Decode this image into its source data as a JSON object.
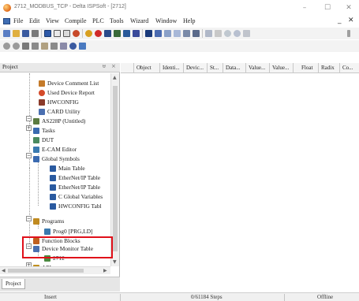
{
  "window": {
    "title": "2712_MODBUS_TCP - Delta ISPSoft - [2712]",
    "controls": [
      "–",
      "☐",
      "✕"
    ]
  },
  "menubar": {
    "items": [
      "File",
      "Edit",
      "View",
      "Compile",
      "PLC",
      "Tools",
      "Wizard",
      "Window",
      "Help"
    ],
    "right_controls": [
      "_",
      "✕"
    ]
  },
  "project_panel": {
    "title": "Project",
    "pin_glyph": "ᵾ",
    "close_glyph": "×",
    "tab_label": "Project",
    "tree": [
      {
        "label": "Device Comment List",
        "icon": "comment-list-icon",
        "color": "#c47a2a"
      },
      {
        "label": "Used Device Report",
        "icon": "report-icon",
        "color": "#d44a2a"
      },
      {
        "label": "HWCONFIG",
        "icon": "hwconfig-icon",
        "color": "#8a3a2a"
      },
      {
        "label": "CARD Utility",
        "icon": "card-icon",
        "color": "#4a6fb0"
      },
      {
        "label": "AS228P (Untitled)",
        "icon": "plc-icon",
        "color": "#5a7a40"
      },
      {
        "label": "Tasks",
        "icon": "tasks-icon",
        "color": "#3a6ab0"
      },
      {
        "label": "DUT",
        "icon": "dut-icon",
        "color": "#4a8a60"
      },
      {
        "label": "E-CAM Editor",
        "icon": "ecam-icon",
        "color": "#3a7ab0"
      },
      {
        "label": "Global Symbols",
        "icon": "global-symbols-icon",
        "color": "#3a6ab0"
      },
      {
        "label": "Main Table",
        "icon": "main-table-icon",
        "color": "#2a5aa0"
      },
      {
        "label": "EtherNet/IP Table",
        "icon": "ethernet-ip-table-icon",
        "color": "#2a5aa0"
      },
      {
        "label": "EtherNet/IP Table",
        "icon": "ethernet-ip-table-icon",
        "color": "#2a5aa0"
      },
      {
        "label": "C Global Variables",
        "icon": "c-global-variables-icon",
        "color": "#2a5aa0"
      },
      {
        "label": "HWCONFIG Tabl",
        "icon": "hwconfig-table-icon",
        "color": "#2a5aa0"
      },
      {
        "label": "Programs",
        "icon": "programs-icon",
        "color": "#c08a20"
      },
      {
        "label": "Prog0 [PRG,LD]",
        "icon": "ld-program-icon",
        "color": "#3a7ab0"
      },
      {
        "label": "Function Blocks",
        "icon": "function-blocks-icon",
        "color": "#c06020"
      },
      {
        "label": "Device Monitor Table",
        "icon": "device-monitor-table-icon",
        "color": "#4a6fb0"
      },
      {
        "label": "2712",
        "icon": "monitor-table-icon",
        "color": "#4a8a40"
      },
      {
        "label": "APIs",
        "icon": "apis-icon",
        "color": "#c09020"
      }
    ]
  },
  "grid": {
    "columns": [
      "Object",
      "Identi...",
      "Devic...",
      "St...",
      "Data...",
      "Value...",
      "Value...",
      "Float",
      "Radix",
      "Co..."
    ]
  },
  "statusbar": {
    "mode": "Insert",
    "steps": "0/61184 Steps",
    "connection": "Offline"
  }
}
